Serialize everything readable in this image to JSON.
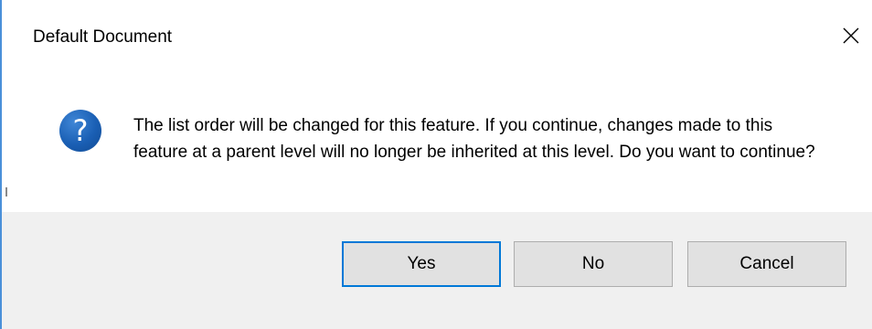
{
  "dialog": {
    "title": "Default Document",
    "message": "The list order will be changed for this feature. If you continue, changes made to this feature at a parent level will no longer be inherited at this level. Do you want to continue?",
    "icon": "question-icon",
    "icon_glyph": "?",
    "close_icon": "close-icon"
  },
  "buttons": {
    "yes_label": "Yes",
    "no_label": "No",
    "cancel_label": "Cancel"
  },
  "colors": {
    "accent": "#0078d7",
    "icon_blue": "#1a5fb4",
    "footer_bg": "#f0f0f0",
    "button_bg": "#e1e1e1"
  }
}
